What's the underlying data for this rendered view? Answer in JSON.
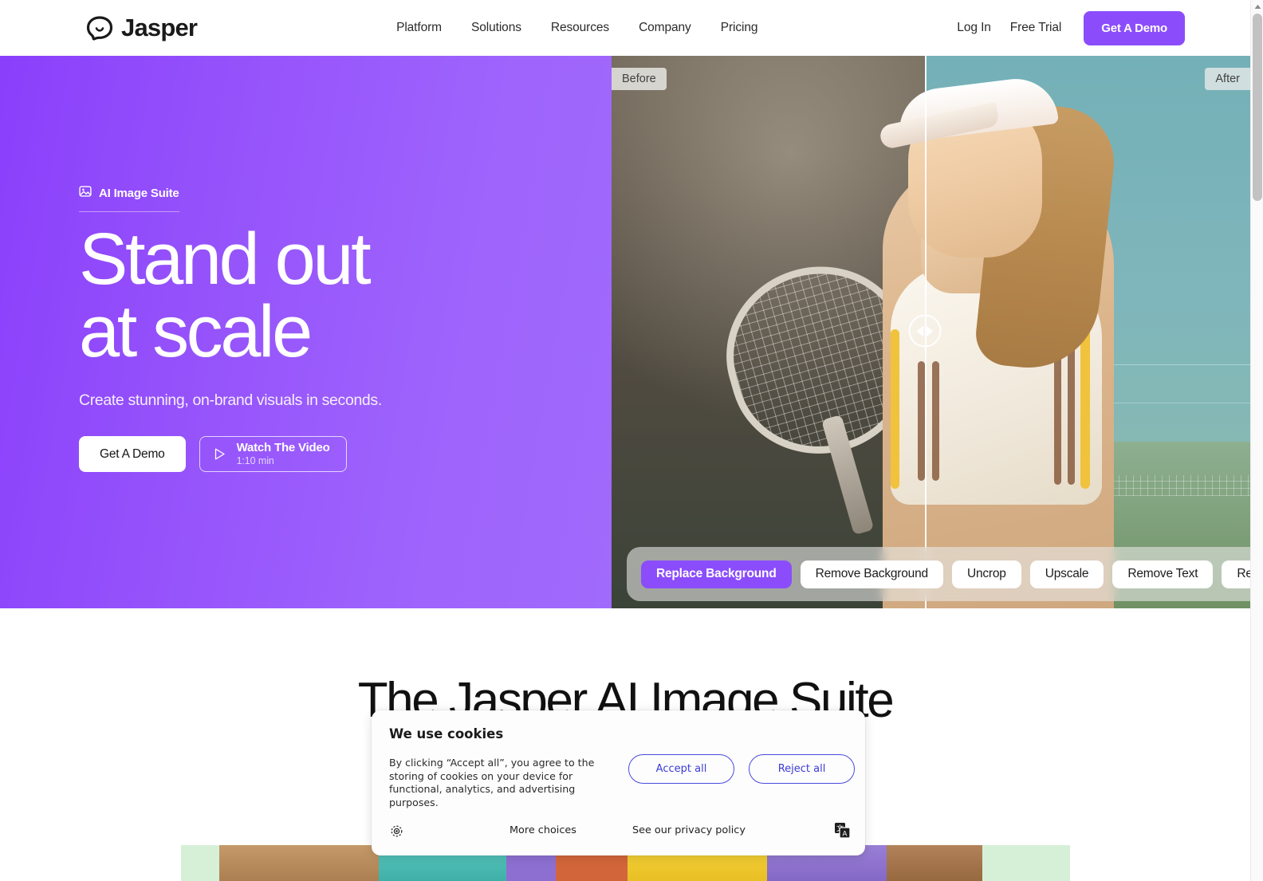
{
  "brand": {
    "name": "Jasper",
    "accent_purple": "#8b4dfb",
    "hero_purple": "#9450fb"
  },
  "nav": {
    "logo_text": "Jasper",
    "links": [
      {
        "label": "Platform"
      },
      {
        "label": "Solutions"
      },
      {
        "label": "Resources"
      },
      {
        "label": "Company"
      },
      {
        "label": "Pricing"
      }
    ],
    "login_label": "Log In",
    "free_trial_label": "Free Trial",
    "demo_label": "Get A Demo"
  },
  "hero": {
    "eyebrow": "AI Image Suite",
    "heading_line1": "Stand out",
    "heading_line2": "at scale",
    "subheading": "Create stunning, on-brand visuals in seconds.",
    "cta_primary": "Get A Demo",
    "cta_video_title": "Watch The Video",
    "cta_video_time": "1:10 min"
  },
  "comparison": {
    "before_label": "Before",
    "after_label": "After",
    "tools": [
      {
        "label": "Replace Background",
        "active": true
      },
      {
        "label": "Remove Background",
        "active": false
      },
      {
        "label": "Uncrop",
        "active": false
      },
      {
        "label": "Upscale",
        "active": false
      },
      {
        "label": "Remove Text",
        "active": false
      },
      {
        "label": "Reimagine",
        "active": false
      }
    ]
  },
  "section2": {
    "title": "The Jasper AI Image Suite"
  },
  "cookie": {
    "title": "We use cookies",
    "body": "By clicking “Accept all”, you agree to the storing of cookies on your device for functional, analytics, and advertising purposes.",
    "accept_label": "Accept all",
    "reject_label": "Reject all",
    "more_choices_label": "More choices",
    "privacy_label": "See our privacy policy"
  }
}
